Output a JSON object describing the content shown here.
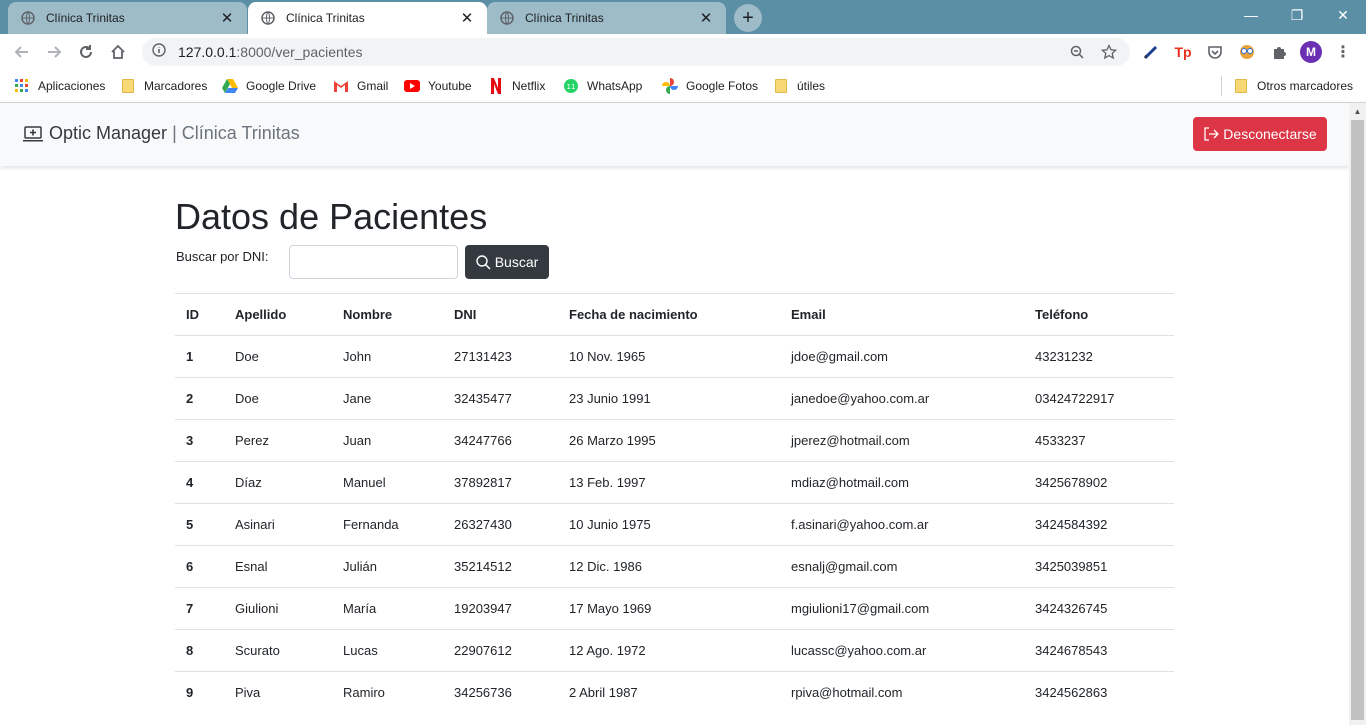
{
  "browser": {
    "tabs": [
      {
        "title": "Clínica Trinitas",
        "active": false
      },
      {
        "title": "Clínica Trinitas",
        "active": true
      },
      {
        "title": "Clínica Trinitas",
        "active": false
      }
    ],
    "url_host": "127.0.0.1",
    "url_path": ":8000/ver_pacientes",
    "avatar_letter": "M",
    "bookmarks": [
      {
        "label": "Aplicaciones",
        "icon": "apps-grid-icon"
      },
      {
        "label": "Marcadores",
        "icon": "folder-icon"
      },
      {
        "label": "Google Drive",
        "icon": "google-drive-icon"
      },
      {
        "label": "Gmail",
        "icon": "gmail-icon"
      },
      {
        "label": "Youtube",
        "icon": "youtube-icon"
      },
      {
        "label": "Netflix",
        "icon": "netflix-icon"
      },
      {
        "label": "WhatsApp",
        "icon": "whatsapp-icon"
      },
      {
        "label": "Google Fotos",
        "icon": "google-photos-icon"
      },
      {
        "label": "útiles",
        "icon": "folder-icon"
      }
    ],
    "other_bookmarks": "Otros marcadores"
  },
  "navbar": {
    "brand": "Optic Manager",
    "brand_sub": "| Clínica Trinitas",
    "logout_label": "Desconectarse",
    "logout_color": "#dc3545"
  },
  "page": {
    "title": "Datos de Pacientes",
    "search_label": "Buscar por DNI:",
    "search_value": "",
    "search_button": "Buscar"
  },
  "table": {
    "headers": [
      "ID",
      "Apellido",
      "Nombre",
      "DNI",
      "Fecha de nacimiento",
      "Email",
      "Teléfono"
    ],
    "rows": [
      [
        "1",
        "Doe",
        "John",
        "27131423",
        "10 Nov. 1965",
        "jdoe@gmail.com",
        "43231232"
      ],
      [
        "2",
        "Doe",
        "Jane",
        "32435477",
        "23 Junio 1991",
        "janedoe@yahoo.com.ar",
        "03424722917"
      ],
      [
        "3",
        "Perez",
        "Juan",
        "34247766",
        "26 Marzo 1995",
        "jperez@hotmail.com",
        "4533237"
      ],
      [
        "4",
        "Díaz",
        "Manuel",
        "37892817",
        "13 Feb. 1997",
        "mdiaz@hotmail.com",
        "3425678902"
      ],
      [
        "5",
        "Asinari",
        "Fernanda",
        "26327430",
        "10 Junio 1975",
        "f.asinari@yahoo.com.ar",
        "3424584392"
      ],
      [
        "6",
        "Esnal",
        "Julián",
        "35214512",
        "12 Dic. 1986",
        "esnalj@gmail.com",
        "3425039851"
      ],
      [
        "7",
        "Giulioni",
        "María",
        "19203947",
        "17 Mayo 1969",
        "mgiulioni17@gmail.com",
        "3424326745"
      ],
      [
        "8",
        "Scurato",
        "Lucas",
        "22907612",
        "12 Ago. 1972",
        "lucassc@yahoo.com.ar",
        "3424678543"
      ],
      [
        "9",
        "Piva",
        "Ramiro",
        "34256736",
        "2 Abril 1987",
        "rpiva@hotmail.com",
        "3424562863"
      ]
    ]
  }
}
